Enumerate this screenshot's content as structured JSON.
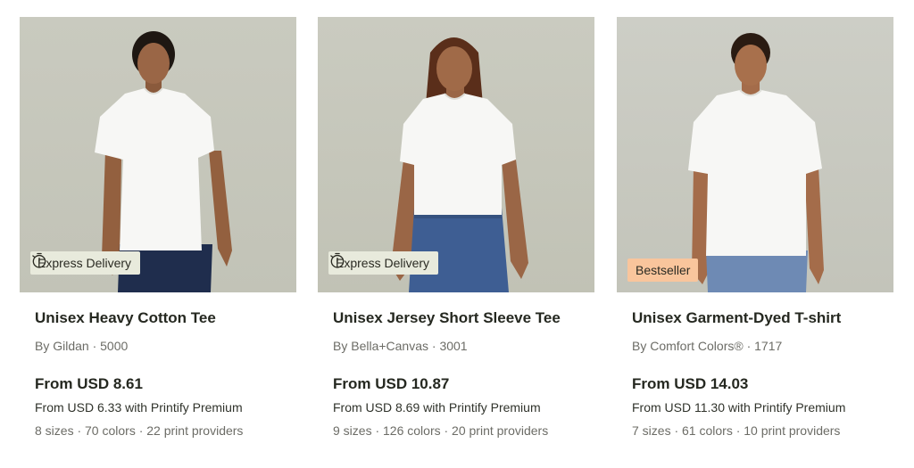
{
  "products": [
    {
      "title": "Unisex Heavy Cotton Tee",
      "brand": "By Gildan · 5000",
      "price": "From USD 8.61",
      "premium_price": "From USD 6.33 with Printify Premium",
      "meta": "8 sizes · 70 colors · 22 print providers",
      "badge": "Express Delivery",
      "badge_icon": "stopwatch-icon"
    },
    {
      "title": "Unisex Jersey Short Sleeve Tee",
      "brand": "By Bella+Canvas · 3001",
      "price": "From USD 10.87",
      "premium_price": "From USD 8.69 with Printify Premium",
      "meta": "9 sizes · 126 colors · 20 print providers",
      "badge": "Express Delivery",
      "badge_icon": "stopwatch-icon"
    },
    {
      "title": "Unisex Garment-Dyed T-shirt",
      "brand": "By Comfort Colors® · 1717",
      "price": "From USD 14.03",
      "premium_price": "From USD 11.30 with Printify Premium",
      "meta": "7 sizes · 61 colors · 10 print providers",
      "badge": "Bestseller"
    }
  ],
  "colors": {
    "express_badge_bg": "#e8eadc",
    "bestseller_badge_bg": "#f9c59c",
    "title_text": "#252820",
    "muted_text": "#6c6c66"
  }
}
